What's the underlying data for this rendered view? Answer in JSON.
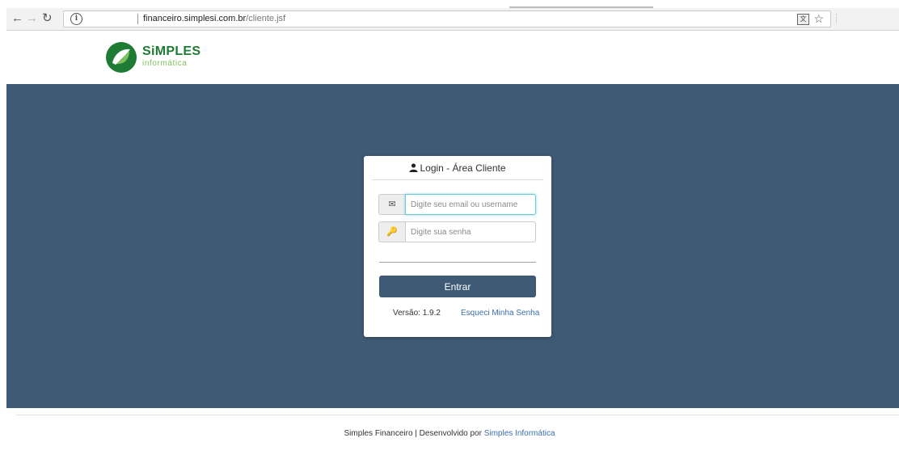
{
  "browser": {
    "url_host": "financeiro.simplesi.com.br",
    "url_path": "/cliente.jsf",
    "icons": {
      "back": "arrow-left-icon",
      "forward": "arrow-right-icon",
      "reload": "reload-icon",
      "info": "info-icon",
      "translate": "translate-icon",
      "bookmark": "star-icon"
    }
  },
  "header": {
    "logo_main": "SiMPLES",
    "logo_sub": "informática",
    "brand_colors": {
      "dark_green": "#1e7b34",
      "light_green": "#7fbf5e"
    }
  },
  "login": {
    "title": "Login - Área Cliente",
    "email_placeholder": "Digite seu email ou username",
    "email_value": "",
    "password_placeholder": "Digite sua senha",
    "password_value": "",
    "submit_label": "Entrar",
    "version": "Versão: 1.9.2",
    "forgot_label": "Esqueci Minha Senha",
    "icons": {
      "title": "user-icon",
      "email": "envelope-icon",
      "password": "key-icon"
    }
  },
  "footer": {
    "text": "Simples Financeiro | Desenvolvido por ",
    "link_label": "Simples Informática"
  },
  "colors": {
    "primary": "#3f5a74",
    "link": "#3a6fb0",
    "focus": "#66c8d8"
  }
}
